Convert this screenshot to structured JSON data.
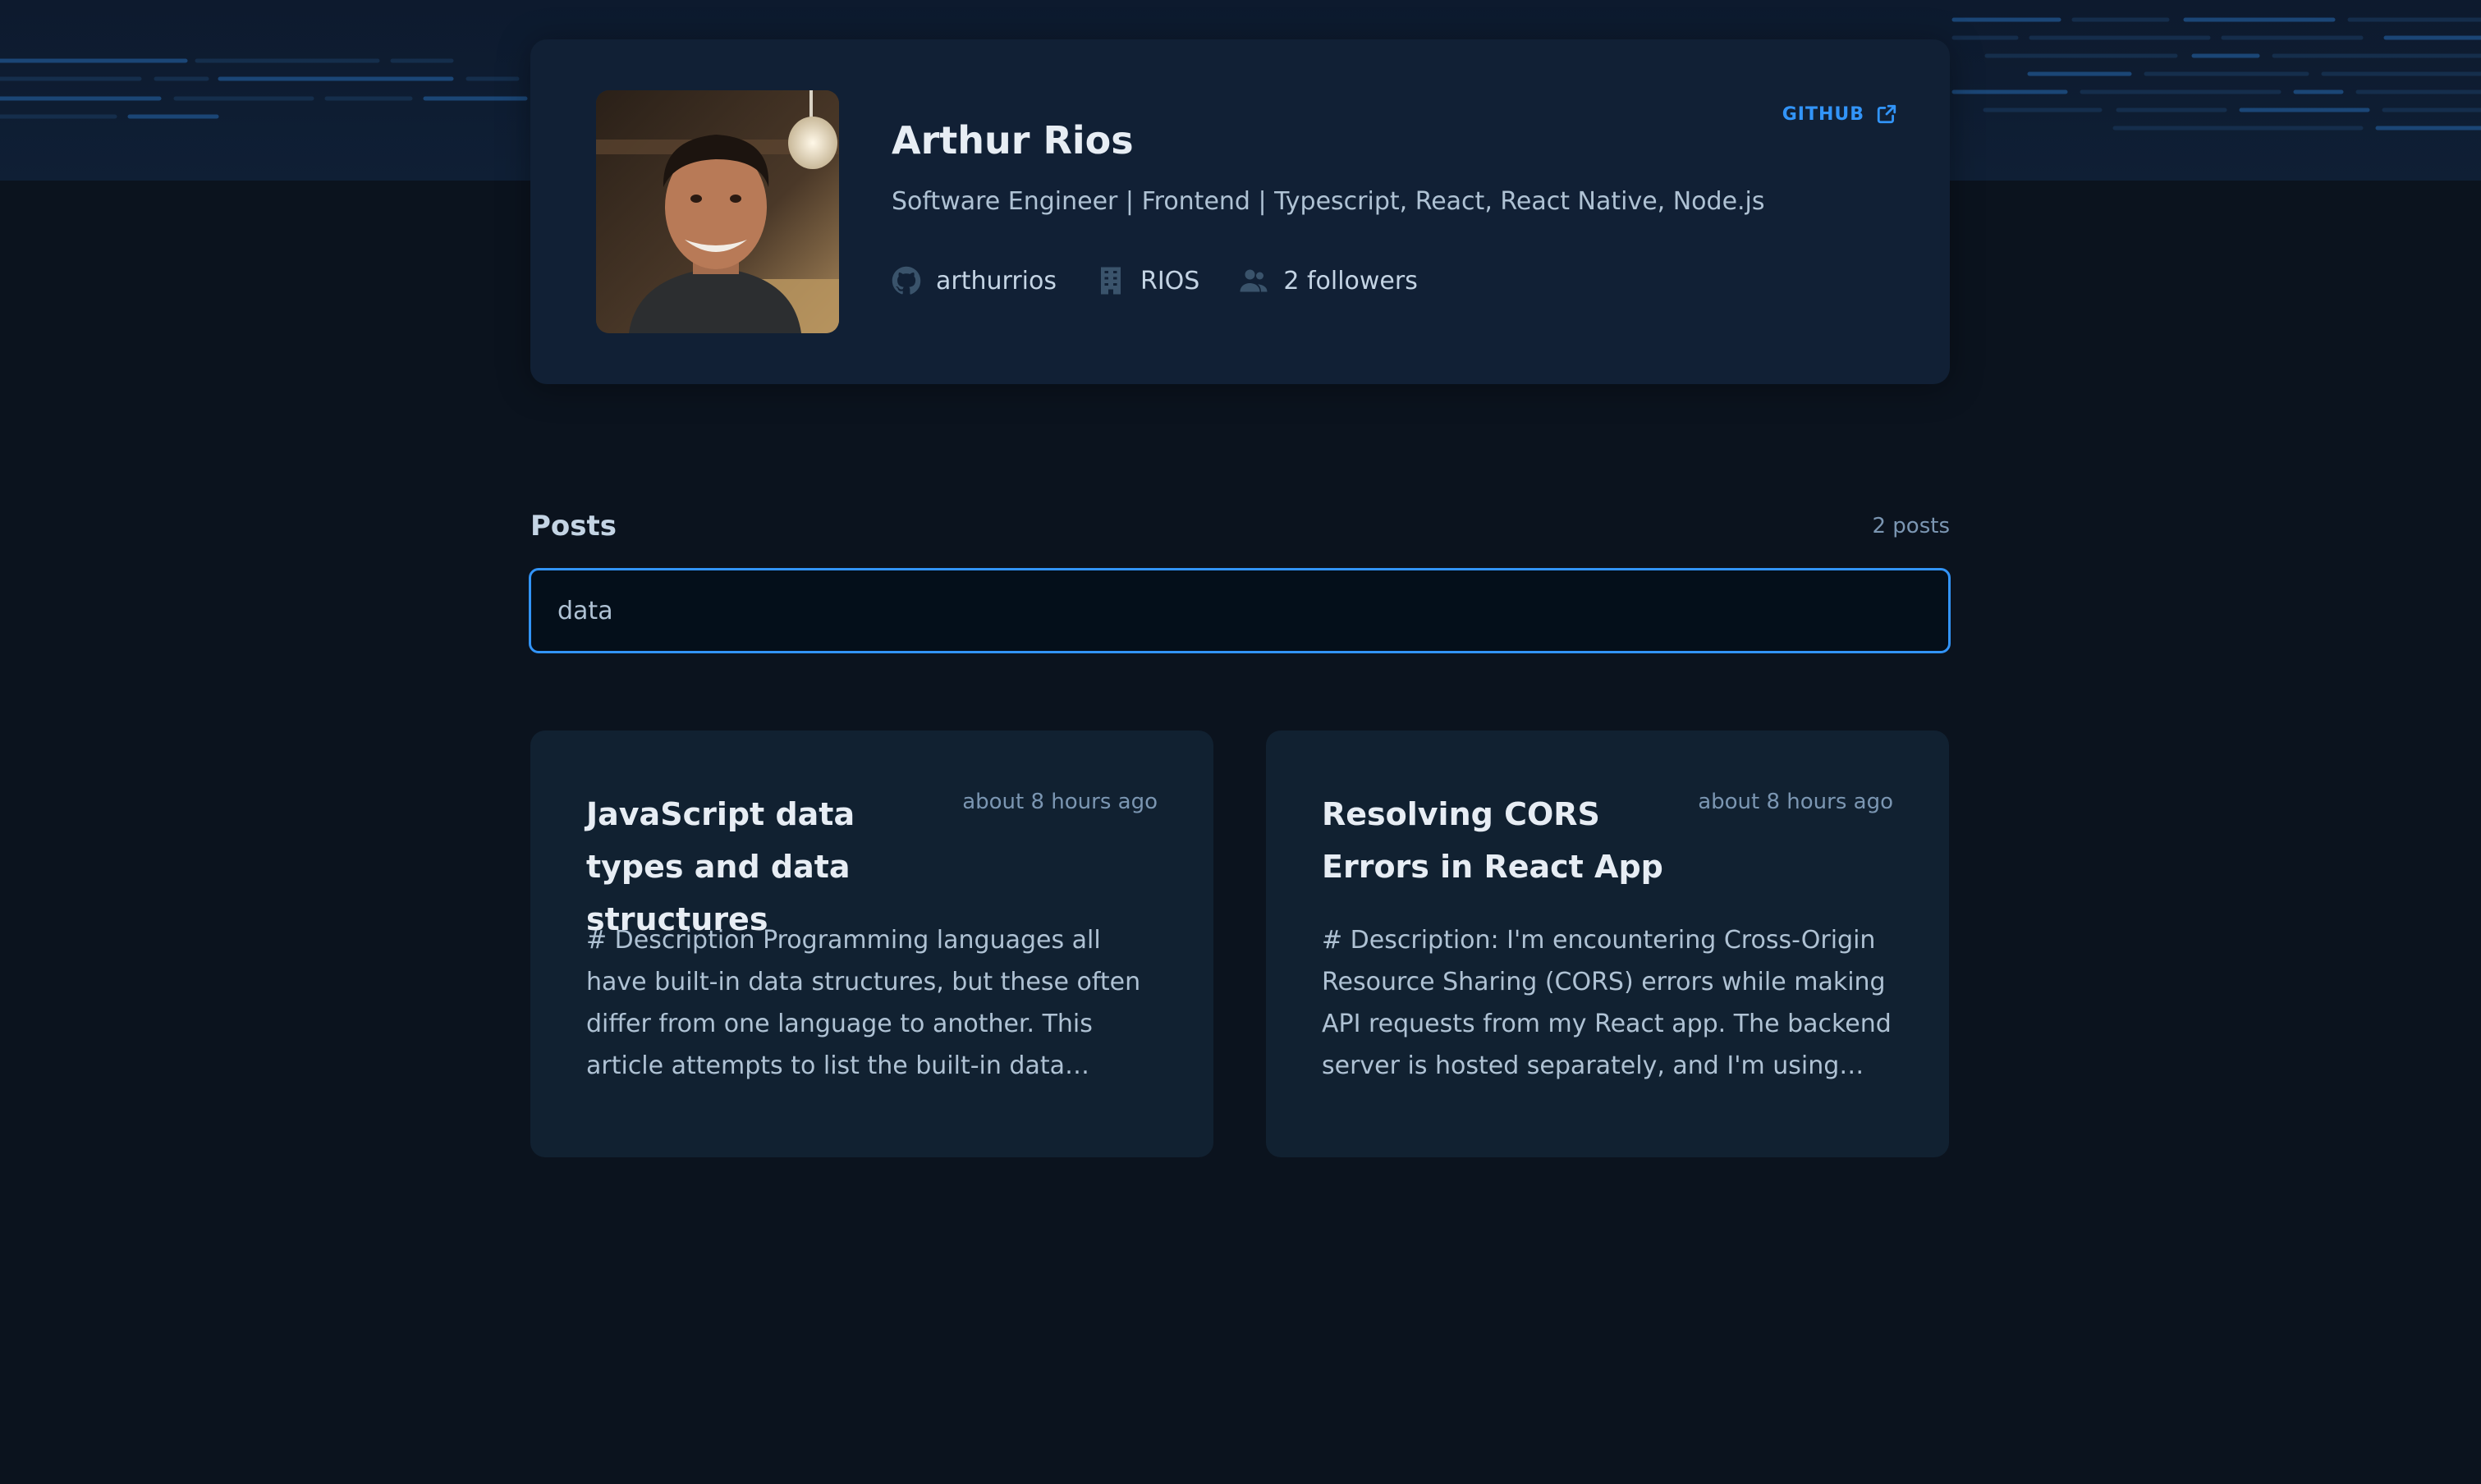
{
  "colors": {
    "background": "#0b131e",
    "card": "#112035",
    "accent": "#3294f8",
    "title": "#e7edf4",
    "text": "#afc2d4",
    "muted": "#7b96b2"
  },
  "profile": {
    "name": "Arthur Rios",
    "bio": "Software Engineer | Frontend | Typescript, React, React Native, Node.js",
    "username": "arthurrios",
    "company": "RIOS",
    "followers": "2 followers",
    "github_link": "GITHUB",
    "icons": {
      "username": "github-icon",
      "company": "building-icon",
      "followers": "users-icon",
      "github_link": "external-link-icon"
    }
  },
  "posts": {
    "title": "Posts",
    "count": "2 posts",
    "search": {
      "value": "data"
    },
    "items": [
      {
        "title": "JavaScript data types and data structures",
        "time": "about 8 hours ago",
        "excerpt": "# Description Programming languages all have built-in data structures, but these often differ from one language to another. This article attempts to list the built-in data structures..."
      },
      {
        "title": "Resolving CORS Errors in React App",
        "time": "about 8 hours ago",
        "excerpt": "# Description: I'm encountering Cross-Origin Resource Sharing (CORS) errors while making API requests from my React app. The backend server is hosted separately, and I'm using axios..."
      }
    ]
  }
}
